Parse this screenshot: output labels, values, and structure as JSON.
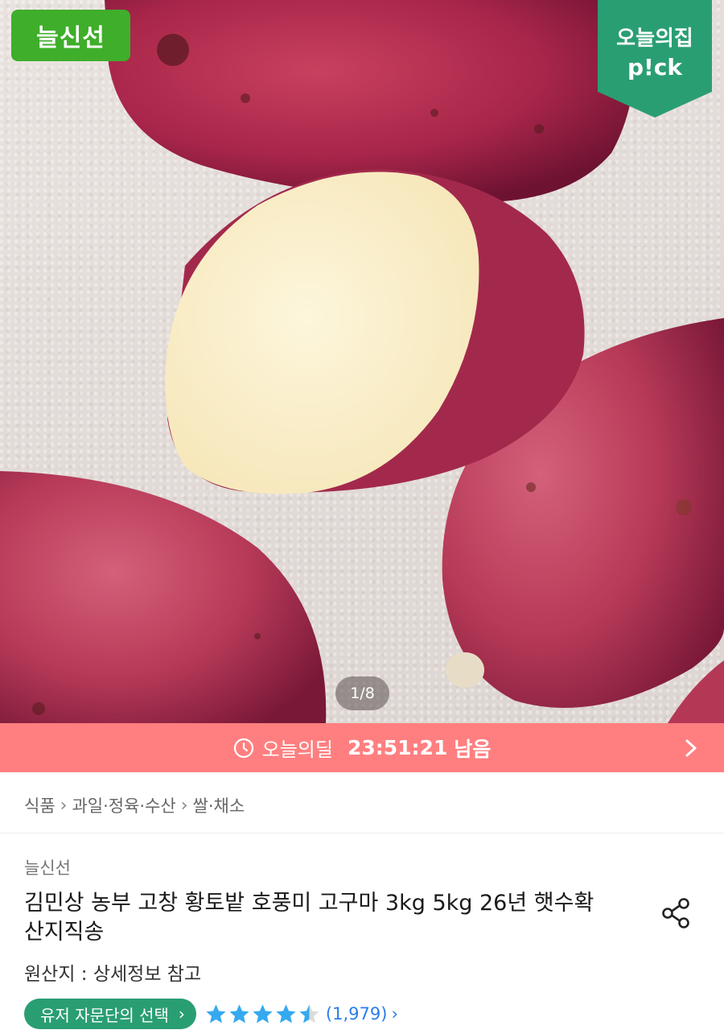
{
  "hero": {
    "badge_left": "늘신선",
    "badge_right_line1": "오늘의집",
    "badge_right_line2": "p!ck",
    "page_counter": "1/8",
    "image_icon": "sweet-potato-photo"
  },
  "deal": {
    "label": "오늘의딜",
    "time": "23:51:21",
    "remain": "남음",
    "icon": "clock-icon"
  },
  "breadcrumb": {
    "items": [
      "식품",
      "과일·정육·수산",
      "쌀·채소"
    ]
  },
  "product": {
    "brand": "늘신선",
    "title": "김민상 농부 고창 황토밭 호풍미 고구마 3kg 5kg 26년 햇수확 산지직송",
    "origin": "원산지 : 상세정보 참고",
    "award": "유저 자문단의 선택",
    "rating": 4.5,
    "review_count": "(1,979)"
  },
  "colors": {
    "deal_bar": "#ff7f80",
    "badge_green": "#3fae2a",
    "pick_green": "#2a9e73",
    "star_blue": "#35a9ef",
    "link_blue": "#2b7de9"
  }
}
